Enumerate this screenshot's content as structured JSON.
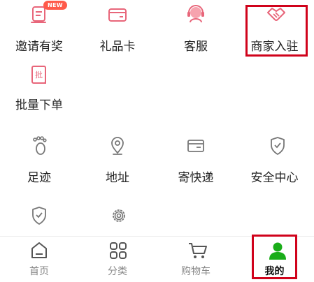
{
  "services": {
    "row1": [
      {
        "label": "邀请有奖",
        "icon": "invite-icon",
        "badge": "NEW"
      },
      {
        "label": "礼品卡",
        "icon": "gift-card-icon"
      },
      {
        "label": "客服",
        "icon": "customer-service-icon"
      },
      {
        "label": "商家入驻",
        "icon": "handshake-icon"
      }
    ],
    "row2": [
      {
        "label": "批量下单",
        "icon": "batch-order-icon"
      }
    ],
    "row3": [
      {
        "label": "足迹",
        "icon": "footprint-icon"
      },
      {
        "label": "地址",
        "icon": "location-icon"
      },
      {
        "label": "寄快递",
        "icon": "parcel-icon"
      },
      {
        "label": "安全中心",
        "icon": "shield-check-icon"
      }
    ],
    "row4": [
      {
        "icon": "shield-check-icon"
      },
      {
        "icon": "gear-icon"
      }
    ]
  },
  "bottom_nav": [
    {
      "label": "首页",
      "icon": "home-icon"
    },
    {
      "label": "分类",
      "icon": "category-icon"
    },
    {
      "label": "购物车",
      "icon": "cart-icon"
    },
    {
      "label": "我的",
      "icon": "profile-icon",
      "active": true
    }
  ],
  "colors": {
    "accent_pink": "#e8667a",
    "icon_gray": "#777777",
    "active_green": "#1aad19",
    "highlight_red": "#d0021b"
  }
}
